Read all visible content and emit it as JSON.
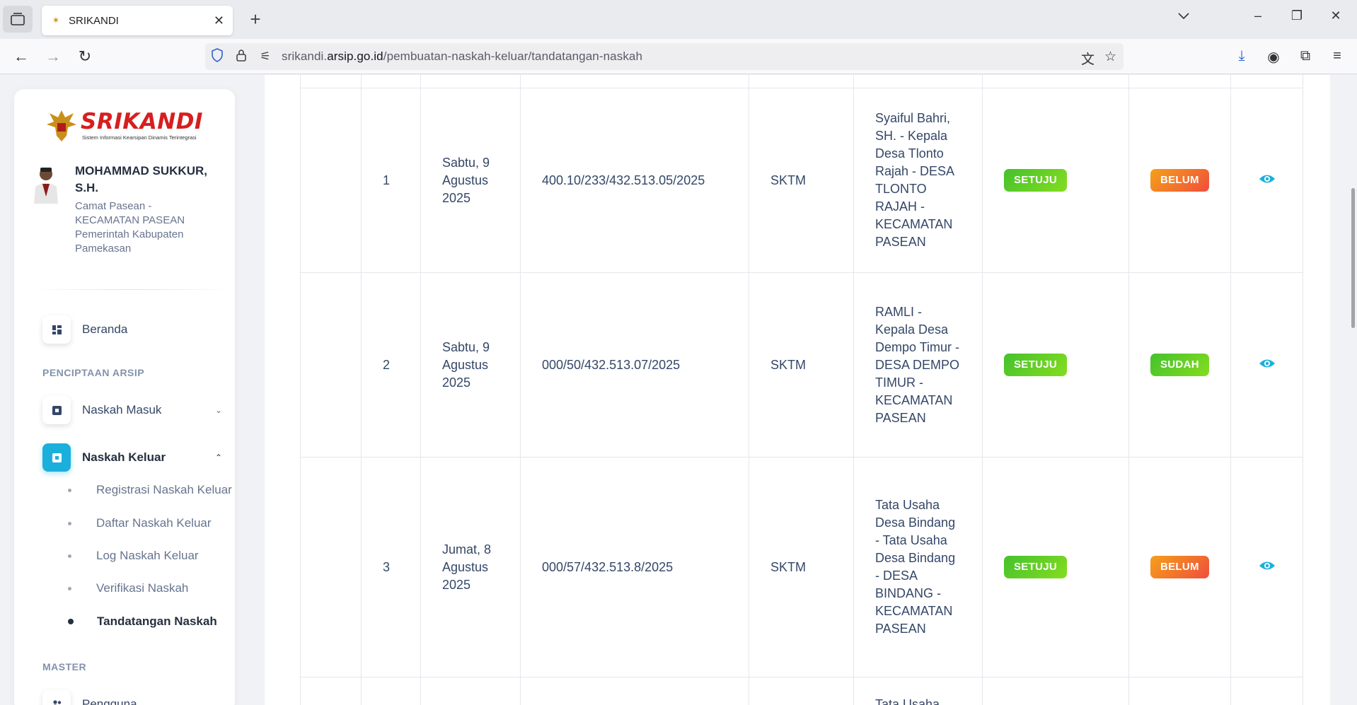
{
  "browser": {
    "tab_title": "SRIKANDI",
    "url_host_prefix": "srikandi.",
    "url_host_main": "arsip.go.id",
    "url_path": "/pembuatan-naskah-keluar/tandatangan-naskah"
  },
  "sidebar": {
    "logo_name": "SRIKANDI",
    "logo_tagline": "Sistem Informasi Kearsipan Dinamis Terintegrasi",
    "user_name": "MOHAMMAD SUKKUR, S.H.",
    "user_role": "Camat Pasean - KECAMATAN PASEAN Pemerintah Kabupaten Pamekasan",
    "beranda": "Beranda",
    "section_penciptaan": "PENCIPTAAN ARSIP",
    "naskah_masuk": "Naskah Masuk",
    "naskah_keluar": "Naskah Keluar",
    "sub": [
      "Registrasi Naskah Keluar",
      "Daftar Naskah Keluar",
      "Log Naskah Keluar",
      "Verifikasi Naskah",
      "Tandatangan Naskah"
    ],
    "section_master": "MASTER",
    "pengguna": "Pengguna"
  },
  "table": {
    "rows": [
      {
        "no": "1",
        "tanggal": "Sabtu, 9 Agustus 2025",
        "nomor": "400.10/233/432.513.05/2025",
        "jenis": "SKTM",
        "pengirim": "Syaiful Bahri, SH. - Kepala Desa Tlonto Rajah - DESA TLONTO RAJAH - KECAMATAN PASEAN",
        "persetujuan": "SETUJU",
        "ttd": "BELUM"
      },
      {
        "no": "2",
        "tanggal": "Sabtu, 9 Agustus 2025",
        "nomor": "000/50/432.513.07/2025",
        "jenis": "SKTM",
        "pengirim": "RAMLI - Kepala Desa Dempo Timur - DESA DEMPO TIMUR - KECAMATAN PASEAN",
        "persetujuan": "SETUJU",
        "ttd": "SUDAH"
      },
      {
        "no": "3",
        "tanggal": "Jumat, 8 Agustus 2025",
        "nomor": "000/57/432.513.8/2025",
        "jenis": "SKTM",
        "pengirim": "Tata Usaha Desa Bindang - Tata Usaha Desa Bindang - DESA BINDANG - KECAMATAN PASEAN",
        "persetujuan": "SETUJU",
        "ttd": "BELUM"
      }
    ],
    "partial_row_text": "Tata Usaha"
  },
  "colors": {
    "accent": "#1bb0dc",
    "badge_green": "#45c12e",
    "badge_orange": "#f27a2b"
  }
}
